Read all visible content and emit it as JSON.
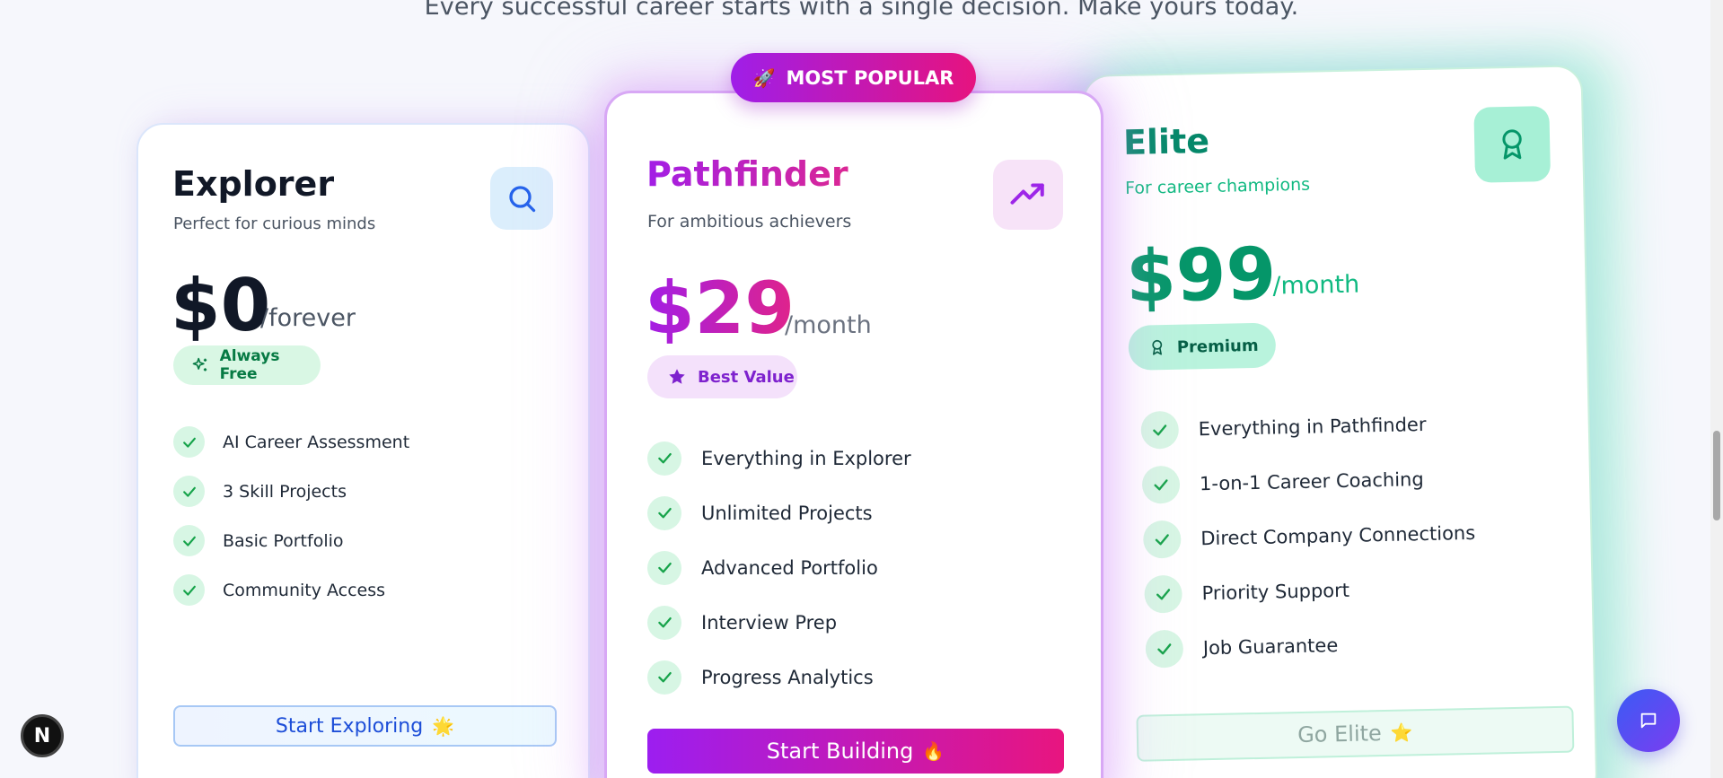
{
  "tagline": "Every successful career starts with a single decision. Make yours today.",
  "popular_ribbon": {
    "emoji": "🚀",
    "label": "MOST POPULAR"
  },
  "plans": {
    "explorer": {
      "name": "Explorer",
      "subtitle": "Perfect for curious minds",
      "icon": "search-icon",
      "price": "$0",
      "period": "/forever",
      "badge": "Always Free",
      "badge_icon": "sparkles-icon",
      "features": [
        "AI Career Assessment",
        "3 Skill Projects",
        "Basic Portfolio",
        "Community Access"
      ],
      "cta": "Start Exploring",
      "cta_emoji": "🌟",
      "accent": "#2563eb"
    },
    "pathfinder": {
      "name": "Pathfinder",
      "subtitle": "For ambitious achievers",
      "icon": "trending-up-icon",
      "price": "$29",
      "period": "/month",
      "badge": "Best Value",
      "badge_icon": "star-icon",
      "features": [
        "Everything in Explorer",
        "Unlimited Projects",
        "Advanced Portfolio",
        "Interview Prep",
        "Progress Analytics"
      ],
      "cta": "Start Building",
      "cta_emoji": "🔥",
      "accent": "#a21ee6"
    },
    "elite": {
      "name": "Elite",
      "subtitle": "For career champions",
      "icon": "award-icon",
      "price": "$99",
      "period": "/month",
      "badge": "Premium",
      "badge_icon": "award-icon",
      "features": [
        "Everything in Pathfinder",
        "1-on-1 Career Coaching",
        "Direct Company Connections",
        "Priority Support",
        "Job Guarantee"
      ],
      "cta": "Go Elite",
      "cta_emoji": "⭐",
      "accent": "#059669"
    }
  },
  "dev_badge": "N",
  "chat_icon": "message-square-icon"
}
